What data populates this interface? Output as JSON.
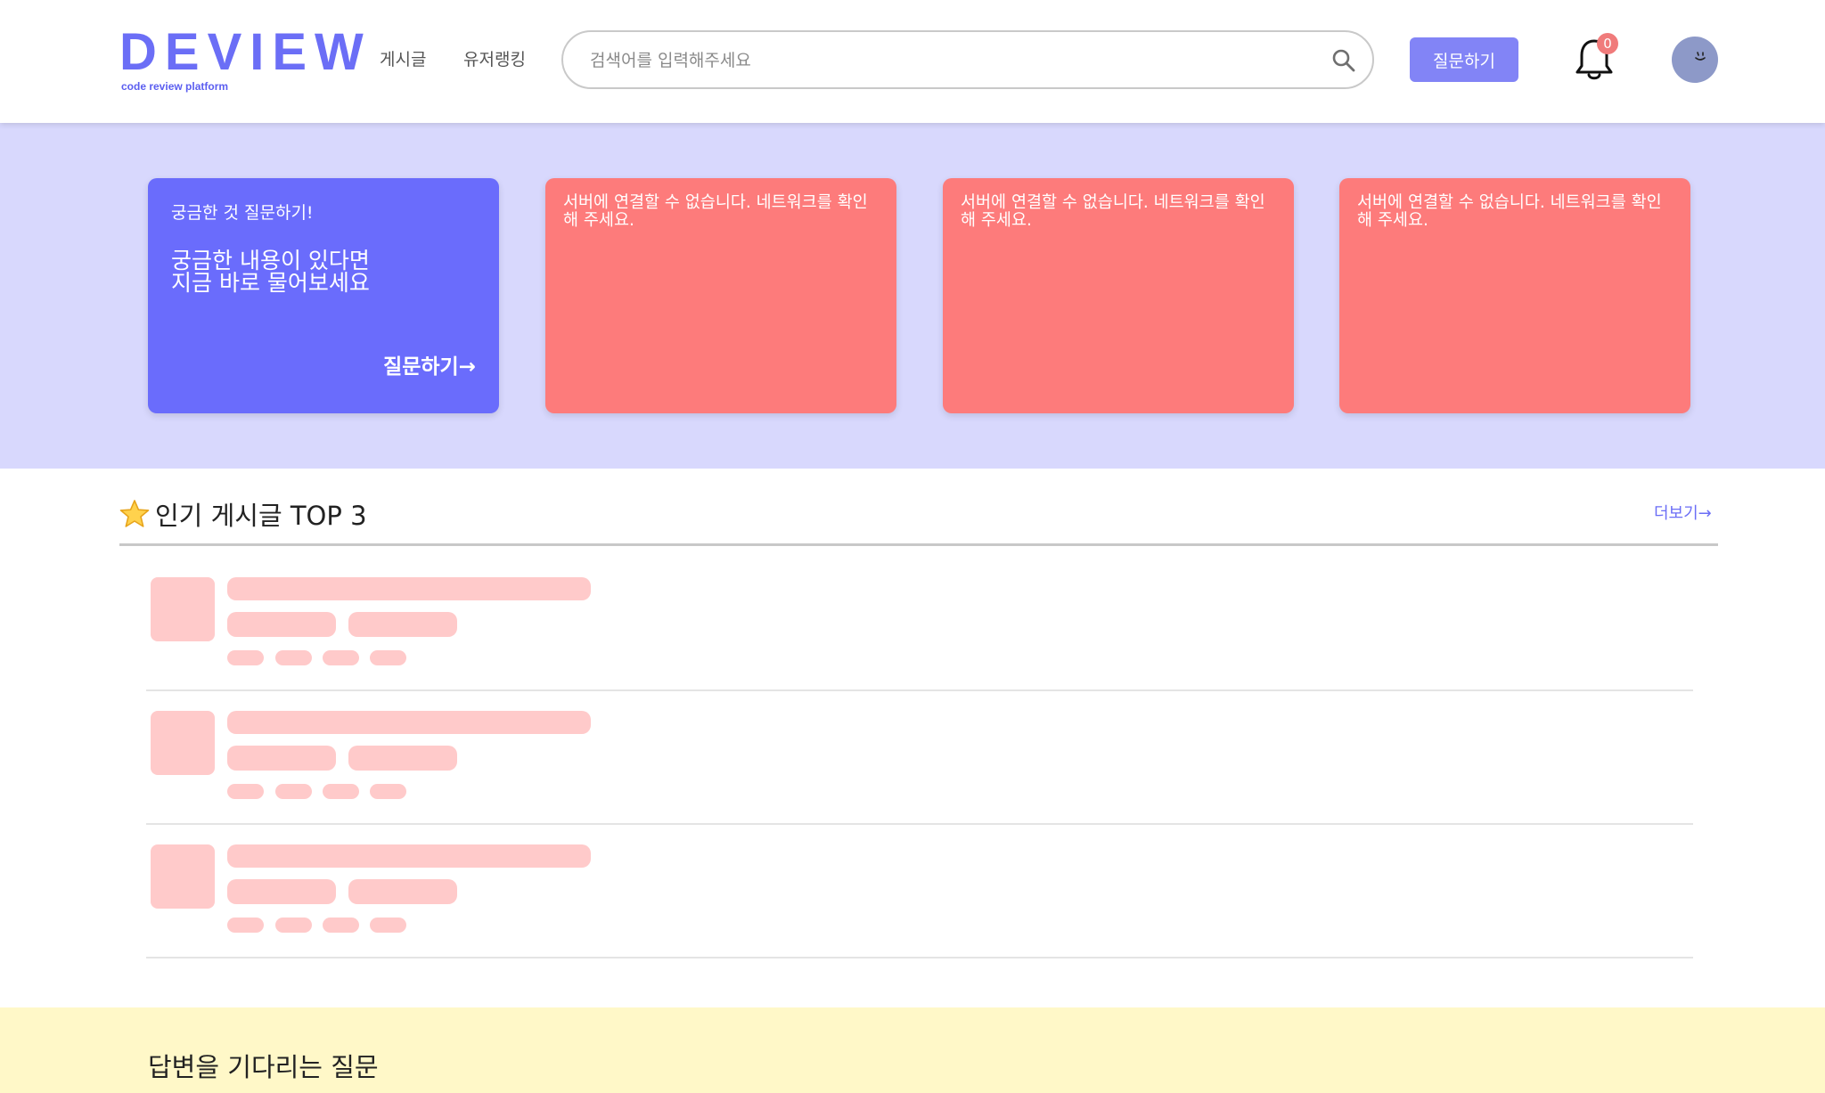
{
  "header": {
    "logo": "DEVIEW",
    "logo_sub": "code review platform",
    "nav": [
      "게시글",
      "유저랭킹"
    ],
    "search": {
      "placeholder": "검색어를 입력해주세요",
      "value": ""
    },
    "ask_button": "질문하기",
    "notification_count": "0"
  },
  "banner": {
    "ask_card": {
      "small": "궁금한 것 질문하기!",
      "big": "궁금한 내용이 있다면\n지금 바로 물어보세요",
      "cta": "질문하기→"
    },
    "error_cards": [
      "서버에 연결할 수 없습니다. 네트워크를 확인해 주세요.",
      "서버에 연결할 수 없습니다. 네트워크를 확인해 주세요.",
      "서버에 연결할 수 없습니다. 네트워크를 확인해 주세요."
    ]
  },
  "popular": {
    "title": "인기 게시글 TOP 3",
    "more": "더보기→"
  },
  "waiting": {
    "title": "답변을 기다리는 질문"
  },
  "colors": {
    "brand": "#6b6ef6",
    "banner_bg": "#d8d8fd",
    "error_card": "#fd7b7b",
    "skeleton": "#ffcaca",
    "waiting_bg": "#fff8c8"
  }
}
